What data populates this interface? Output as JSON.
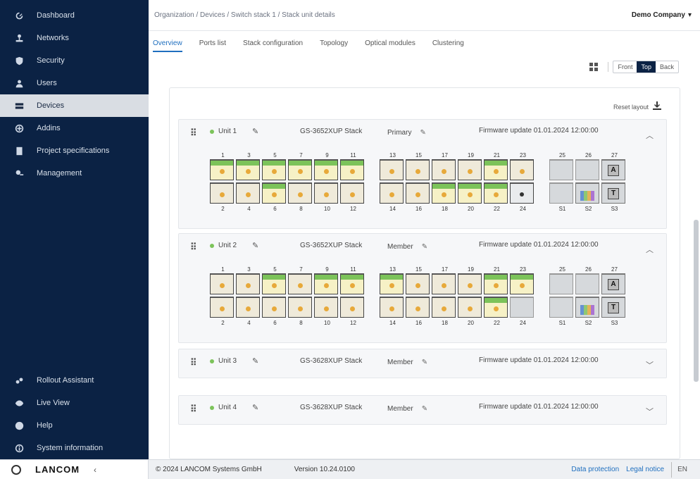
{
  "sidebar": {
    "items": [
      {
        "label": "Dashboard",
        "icon": "dashboard-icon"
      },
      {
        "label": "Networks",
        "icon": "network-icon"
      },
      {
        "label": "Security",
        "icon": "shield-icon"
      },
      {
        "label": "Users",
        "icon": "users-icon"
      },
      {
        "label": "Devices",
        "icon": "devices-icon",
        "active": true
      },
      {
        "label": "Addins",
        "icon": "addins-icon"
      },
      {
        "label": "Project specifications",
        "icon": "specifications-icon"
      },
      {
        "label": "Management",
        "icon": "management-icon"
      }
    ],
    "bottom_items": [
      {
        "label": "Rollout Assistant",
        "icon": "rollout-icon"
      },
      {
        "label": "Live View",
        "icon": "live-view-icon"
      },
      {
        "label": "Help",
        "icon": "help-icon"
      },
      {
        "label": "System information",
        "icon": "info-icon"
      }
    ]
  },
  "header": {
    "breadcrumb": "Organization / Devices / Switch stack 1 / Stack unit details",
    "org_switch": "Demo Company"
  },
  "tabs": [
    {
      "label": "Overview",
      "active": true
    },
    {
      "label": "Ports list"
    },
    {
      "label": "Stack configuration"
    },
    {
      "label": "Topology"
    },
    {
      "label": "Optical modules"
    },
    {
      "label": "Clustering"
    }
  ],
  "view_toggle": {
    "options": [
      "Front",
      "Top",
      "Back"
    ],
    "selected": "Top"
  },
  "panel": {
    "reset_label": "Reset layout"
  },
  "stacks": [
    {
      "unit": "Unit 1",
      "model": "GS-3652XUP Stack",
      "state": "Primary",
      "update": "Firmware update 01.01.2024 12:00:00",
      "expanded": true,
      "groupA_top": [
        "1",
        "3",
        "5",
        "7",
        "9",
        "11"
      ],
      "groupA_bottom": [
        "2",
        "4",
        "6",
        "8",
        "10",
        "12"
      ],
      "groupB_top": [
        "13",
        "15",
        "17",
        "19",
        "21",
        "23"
      ],
      "groupB_bottom": [
        "14",
        "16",
        "18",
        "20",
        "22",
        "24"
      ],
      "groupC_top": [
        "25",
        "26",
        "27"
      ],
      "groupC_bottom": [
        "S1",
        "S2",
        "S3"
      ]
    },
    {
      "unit": "Unit 2",
      "model": "GS-3652XUP Stack",
      "state": "Member",
      "update": "Firmware update 01.01.2024 12:00:00",
      "expanded": true,
      "groupA_top": [
        "1",
        "3",
        "5",
        "7",
        "9",
        "11"
      ],
      "groupA_bottom": [
        "2",
        "4",
        "6",
        "8",
        "10",
        "12"
      ],
      "groupB_top": [
        "13",
        "15",
        "17",
        "19",
        "21",
        "23"
      ],
      "groupB_bottom": [
        "14",
        "16",
        "18",
        "20",
        "22",
        "24"
      ],
      "groupC_top": [
        "25",
        "26",
        "27"
      ],
      "groupC_bottom": [
        "S1",
        "S2",
        "S3"
      ]
    },
    {
      "unit": "Unit 3",
      "model": "GS-3628XUP Stack",
      "state": "Member",
      "update": "Firmware update 01.01.2024 12:00:00",
      "expanded": false
    },
    {
      "unit": "Unit 4",
      "model": "GS-3628XUP Stack",
      "state": "Member",
      "update": "Firmware update 01.01.2024 12:00:00",
      "expanded": false
    }
  ],
  "footer": {
    "brand": "LANCOM",
    "copyright": "© 2024 LANCOM Systems GmbH",
    "version": "Version 10.24.0100",
    "links": [
      "Data protection",
      "Legal notice"
    ],
    "lang": "EN"
  }
}
